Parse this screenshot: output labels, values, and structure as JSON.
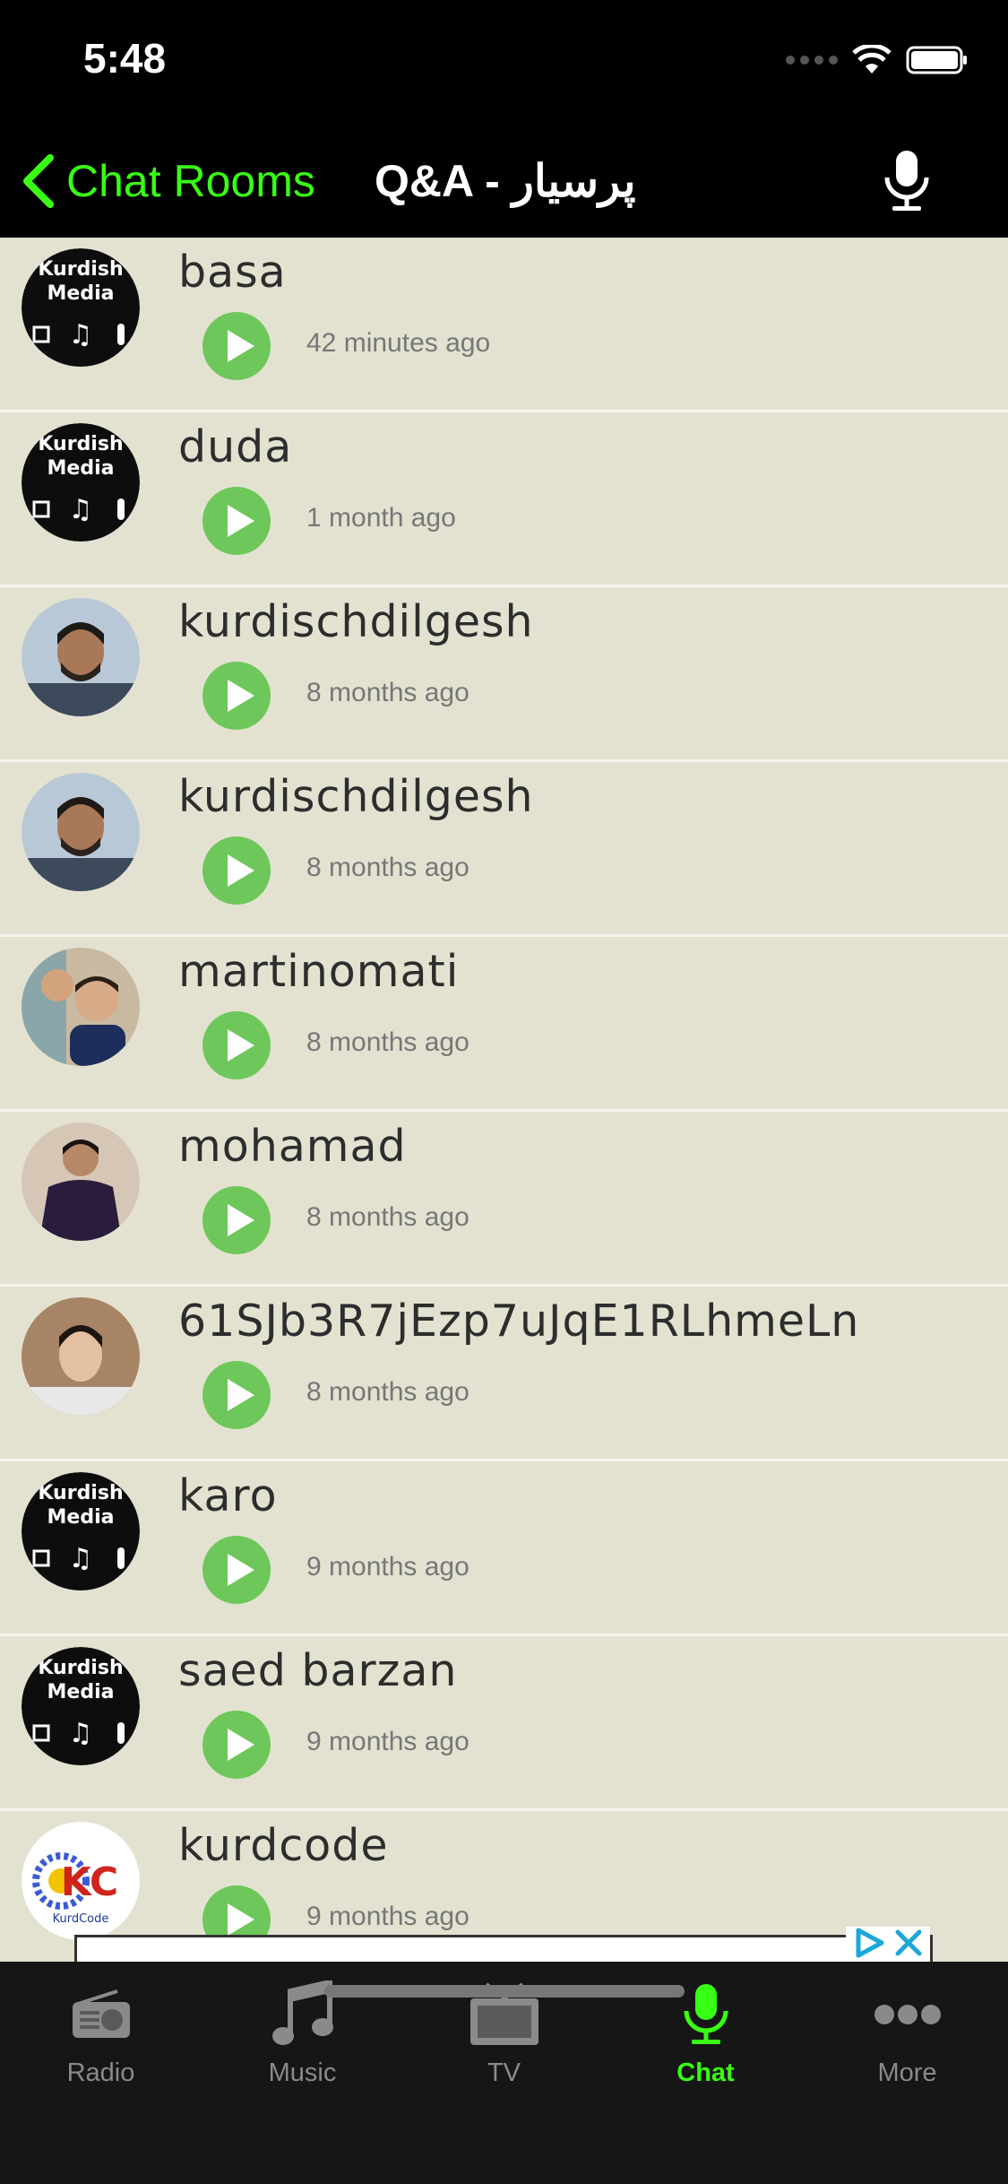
{
  "status": {
    "time": "5:48"
  },
  "nav": {
    "back_label": "Chat Rooms",
    "title": "Q&A - پرسیار"
  },
  "colors": {
    "accent": "#39ff14",
    "play": "#6ec75a",
    "list_bg": "#e3e2d1"
  },
  "messages": [
    {
      "username": "basa",
      "time": "42 minutes ago",
      "avatar": "kurdish-media-logo"
    },
    {
      "username": "duda",
      "time": "1 month ago",
      "avatar": "kurdish-media-logo"
    },
    {
      "username": "kurdischdilgesh",
      "time": "8 months ago",
      "avatar": "user-photo"
    },
    {
      "username": "kurdischdilgesh",
      "time": "8 months ago",
      "avatar": "user-photo"
    },
    {
      "username": "martinomati",
      "time": "8 months ago",
      "avatar": "user-photo"
    },
    {
      "username": "mohamad",
      "time": "8 months ago",
      "avatar": "user-photo"
    },
    {
      "username": "61SJb3R7jEzp7uJqE1RLhmeLn",
      "time": "8 months ago",
      "avatar": "user-photo"
    },
    {
      "username": "karo",
      "time": "9 months ago",
      "avatar": "kurdish-media-logo"
    },
    {
      "username": "saed barzan",
      "time": "9 months ago",
      "avatar": "kurdish-media-logo"
    },
    {
      "username": "kurdcode",
      "time": "9 months ago",
      "avatar": "kurdcode-logo"
    }
  ],
  "logo_text": {
    "kurdish": "Kurdish",
    "media": "Media",
    "kc": "KC",
    "kurdcode": "KurdCode"
  },
  "tabs": [
    {
      "label": "Radio",
      "icon": "radio-icon",
      "active": false
    },
    {
      "label": "Music",
      "icon": "music-note-icon",
      "active": false
    },
    {
      "label": "TV",
      "icon": "tv-icon",
      "active": false
    },
    {
      "label": "Chat",
      "icon": "microphone-icon",
      "active": true
    },
    {
      "label": "More",
      "icon": "more-dots-icon",
      "active": false
    }
  ]
}
